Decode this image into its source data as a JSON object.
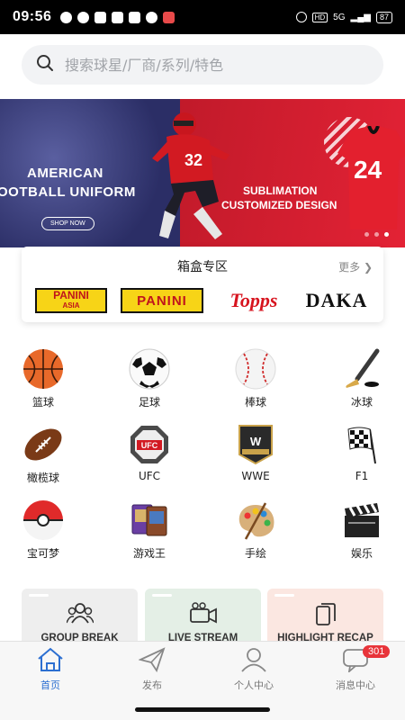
{
  "status_bar": {
    "time": "09:56",
    "battery": "87",
    "signal": "5G"
  },
  "search": {
    "placeholder": "搜索球星/厂商/系列/特色"
  },
  "banner": {
    "left_line1": "AMERICAN",
    "left_line2": "OOTBALL UNIFORM",
    "button": "SHOP NOW",
    "right_line1": "SUBLIMATION",
    "right_line2": "CUSTOMIZED DESIGN",
    "player_number": "32",
    "jersey_number": "24",
    "active_slide": 2,
    "slides": 3
  },
  "box_section": {
    "title": "箱盒专区",
    "more": "更多",
    "brands": [
      {
        "name": "PANINI",
        "sub": "ASIA"
      },
      {
        "name": "PANINI"
      },
      {
        "name": "Topps"
      },
      {
        "name": "DAKA"
      }
    ]
  },
  "categories": [
    {
      "label": "篮球",
      "icon": "basketball-icon"
    },
    {
      "label": "足球",
      "icon": "soccer-ball-icon"
    },
    {
      "label": "棒球",
      "icon": "baseball-icon"
    },
    {
      "label": "冰球",
      "icon": "hockey-stick-icon"
    },
    {
      "label": "橄榄球",
      "icon": "american-football-icon"
    },
    {
      "label": "UFC",
      "icon": "ufc-octagon-icon"
    },
    {
      "label": "WWE",
      "icon": "wwe-logo-icon"
    },
    {
      "label": "F1",
      "icon": "checkered-flag-icon"
    },
    {
      "label": "宝可梦",
      "icon": "pokeball-icon"
    },
    {
      "label": "游戏王",
      "icon": "trading-cards-icon"
    },
    {
      "label": "手绘",
      "icon": "paint-palette-icon"
    },
    {
      "label": "娱乐",
      "icon": "clapperboard-icon"
    }
  ],
  "features": [
    {
      "label": "GROUP BREAK",
      "icon": "group-icon",
      "color": "#eeeeee"
    },
    {
      "label": "LIVE STREAM",
      "icon": "video-camera-icon",
      "color": "#e4efe6"
    },
    {
      "label": "HIGHLIGHT RECAP",
      "icon": "cards-icon",
      "color": "#fbe7e1"
    }
  ],
  "tabs": [
    {
      "label": "首页",
      "icon": "home-icon",
      "active": true
    },
    {
      "label": "发布",
      "icon": "paper-plane-icon",
      "active": false
    },
    {
      "label": "个人中心",
      "icon": "user-icon",
      "active": false
    },
    {
      "label": "消息中心",
      "icon": "message-icon",
      "active": false,
      "badge": "301"
    }
  ],
  "colors": {
    "accent": "#2c6fd1",
    "badge": "#e8343a",
    "banner_red": "#e32235",
    "banner_navy": "#2f3370"
  }
}
